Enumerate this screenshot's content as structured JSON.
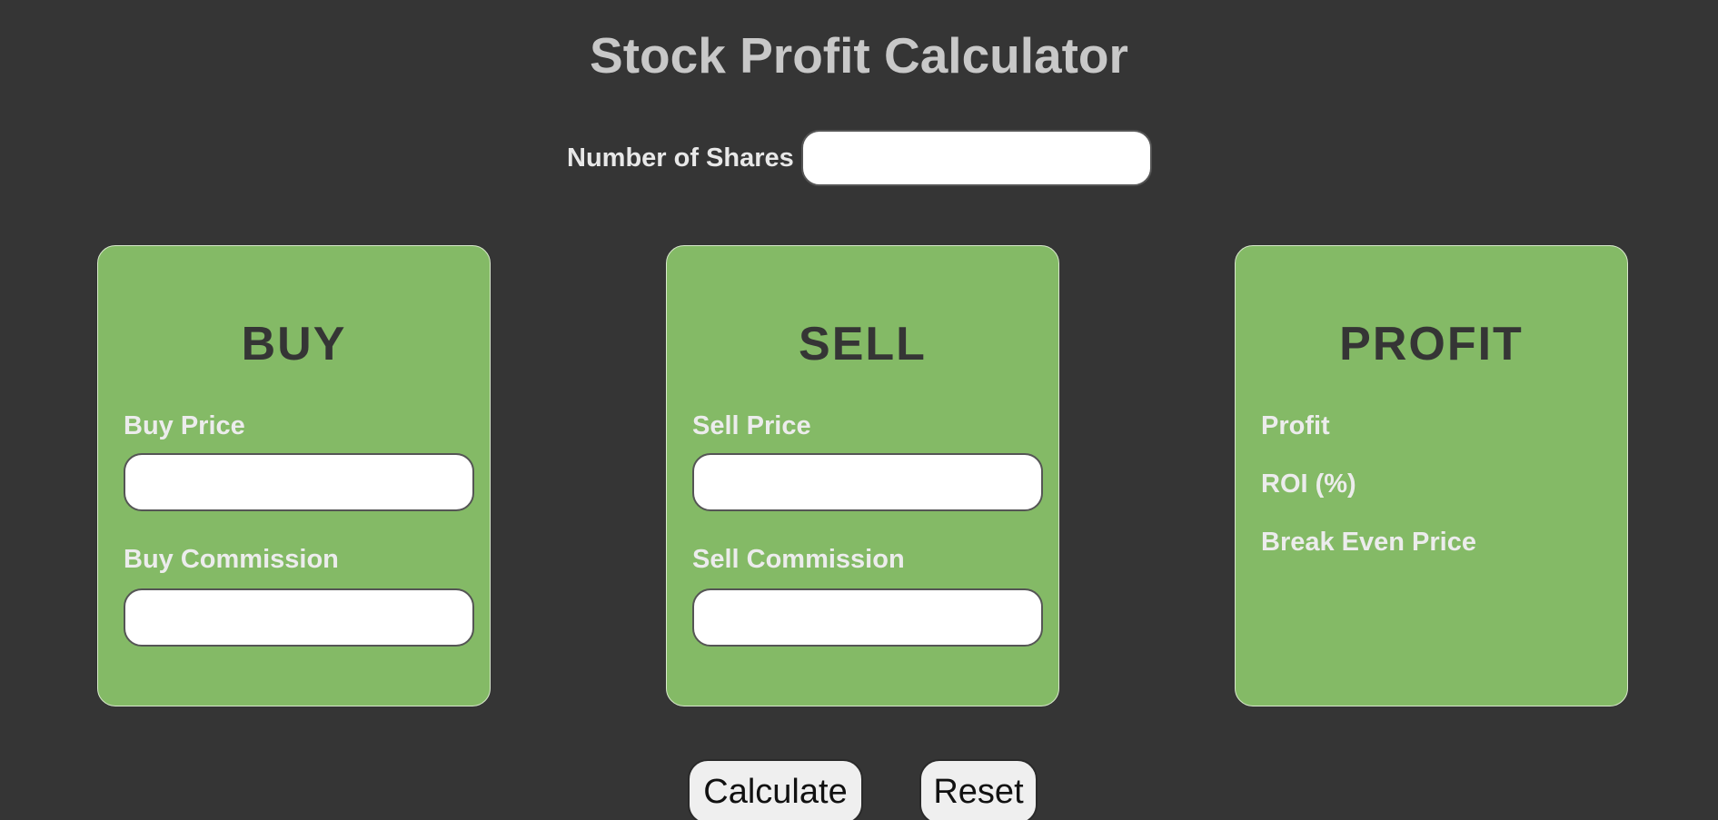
{
  "page": {
    "title": "Stock Profit Calculator"
  },
  "shares": {
    "label": "Number of Shares",
    "value": ""
  },
  "buy": {
    "title": "BUY",
    "price_label": "Buy Price",
    "price_value": "",
    "commission_label": "Buy Commission",
    "commission_value": ""
  },
  "sell": {
    "title": "SELL",
    "price_label": "Sell Price",
    "price_value": "",
    "commission_label": "Sell Commission",
    "commission_value": ""
  },
  "profit": {
    "title": "PROFIT",
    "profit_label": "Profit",
    "roi_label": "ROI (%)",
    "break_even_label": "Break Even Price"
  },
  "actions": {
    "calculate_label": "Calculate",
    "reset_label": "Reset"
  },
  "colors": {
    "background": "#353535",
    "card": "#84ba66",
    "title_text": "#c8c8c8",
    "card_title_text": "#353535"
  }
}
